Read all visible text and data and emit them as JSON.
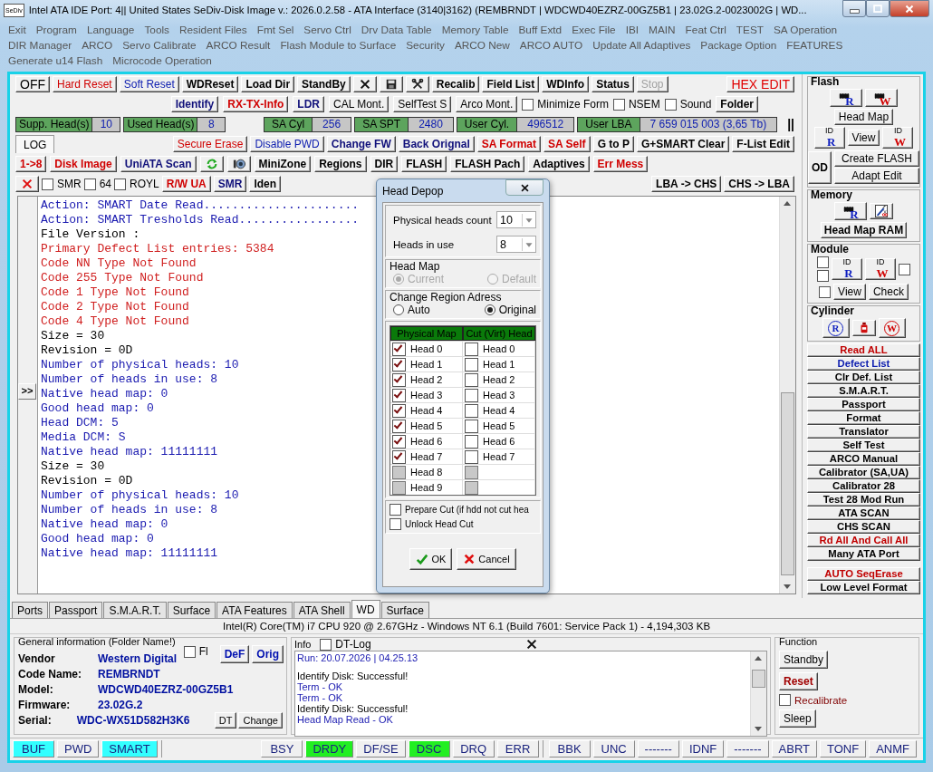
{
  "window": {
    "app_logo": "SeDiv",
    "title": "Intel ATA IDE  Port: 4|| United States  SeDiv-Disk Image v.: 2026.0.2.58 - ATA Interface (3140|3162)  (REMBRNDT | WDCWD40EZRZ-00GZ5B1 | 23.02G.2-0023002G | WD..."
  },
  "menu": [
    "Exit",
    "Program",
    "Language",
    "Tools",
    "Resident Files",
    "Fmt Sel",
    "Servo Ctrl",
    "Drv Data Table",
    "Memory Table",
    "Buff Extd",
    "Exec File",
    "IBI",
    "MAIN",
    "Feat Ctrl",
    "TEST",
    "SA Operation",
    "DIR Manager",
    "ARCO",
    "Servo Calibrate",
    "ARCO Result",
    "Flash Module to Surface",
    "Security",
    "ARCO New",
    "ARCO AUTO",
    "Update All Adaptives",
    "Package Option",
    "FEATURES",
    "Generate u14 Flash",
    "Microcode Operation"
  ],
  "toolbar_rows": [
    {
      "left": [
        {
          "kind": "button",
          "label": "OFF",
          "color": "#000000",
          "bold": false,
          "big": true
        },
        {
          "kind": "button",
          "label": "Hard Reset",
          "color": "#d00000",
          "bold": false
        },
        {
          "kind": "button",
          "label": "Soft Reset",
          "color": "#1020b0",
          "bold": false
        },
        {
          "kind": "button",
          "label": "WDReset",
          "color": "#000000",
          "bold": true
        },
        {
          "kind": "button",
          "label": "Load Dir",
          "color": "#000000",
          "bold": true
        },
        {
          "kind": "button",
          "label": "StandBy",
          "color": "#000000",
          "bold": true
        },
        {
          "kind": "close_button"
        },
        {
          "kind": "save_button"
        },
        {
          "kind": "tools_button"
        },
        {
          "kind": "button",
          "label": "Recalib",
          "color": "#000000",
          "bold": true
        },
        {
          "kind": "button",
          "label": "Field List",
          "color": "#000000",
          "bold": true
        },
        {
          "kind": "button",
          "label": "WDInfo",
          "color": "#000000",
          "bold": true
        },
        {
          "kind": "button",
          "label": "Status",
          "color": "#000000",
          "bold": true
        },
        {
          "kind": "button",
          "label": "Stop",
          "bold": false,
          "disabled": true
        }
      ],
      "right": [
        {
          "kind": "button",
          "label": "HEX EDIT",
          "color": "#e00000",
          "bold": false,
          "big": true
        }
      ]
    },
    {
      "right": [
        {
          "kind": "button",
          "label": "Identify",
          "color": "#10107a",
          "bold": true
        },
        {
          "kind": "button",
          "label": "RX-TX-Info",
          "color": "#d00000",
          "bold": true
        },
        {
          "kind": "button",
          "label": "LDR",
          "color": "#10107a",
          "bold": true
        },
        {
          "kind": "button",
          "label": "CAL Mont.",
          "color": "#000000",
          "bold": false
        },
        {
          "kind": "button",
          "label": "SelfTest S",
          "color": "#000000",
          "bold": false
        },
        {
          "kind": "button",
          "label": "Arco Mont.",
          "color": "#000000",
          "bold": false
        },
        {
          "kind": "checkbox",
          "label": "Minimize Form",
          "checked": false
        },
        {
          "kind": "checkbox",
          "label": "NSEM",
          "checked": false
        },
        {
          "kind": "checkbox",
          "label": "Sound",
          "checked": false
        },
        {
          "kind": "button",
          "label": "Folder",
          "color": "#000000",
          "bold": true
        }
      ]
    },
    {
      "left": [
        {
          "kind": "field",
          "label": "Supp. Head(s)",
          "value": "10"
        },
        {
          "kind": "field",
          "label": "Used Head(s)",
          "value": "8"
        }
      ],
      "right": [
        {
          "kind": "field",
          "label": "SA Cyl",
          "value": "256"
        },
        {
          "kind": "field",
          "label": "SA SPT",
          "value": "2480"
        },
        {
          "kind": "field",
          "label": "User Cyl.",
          "value": "496512"
        },
        {
          "kind": "field",
          "label": "User LBA",
          "value": "7 659 015 003  (3,65 Tb)"
        },
        {
          "kind": "text",
          "label": "||"
        }
      ]
    },
    {
      "left": [
        {
          "kind": "tab",
          "label": "LOG",
          "selected": true
        }
      ],
      "right": [
        {
          "kind": "button",
          "label": "Secure Erase",
          "color": "#d00000",
          "bold": false
        },
        {
          "kind": "button",
          "label": "Disable PWD",
          "color": "#1020b0",
          "bold": false
        },
        {
          "kind": "button",
          "label": "Change FW",
          "color": "#10107a",
          "bold": true
        },
        {
          "kind": "button",
          "label": "Back Orignal",
          "color": "#10107a",
          "bold": true
        },
        {
          "kind": "button",
          "label": "SA Format",
          "color": "#d00000",
          "bold": true
        },
        {
          "kind": "button",
          "label": "SA Self",
          "color": "#d00000",
          "bold": true
        },
        {
          "kind": "button",
          "label": "G to P",
          "color": "#000000",
          "bold": true
        },
        {
          "kind": "button",
          "label": "G+SMART Clear",
          "color": "#000000",
          "bold": true
        },
        {
          "kind": "button",
          "label": "F-List Edit",
          "color": "#000000",
          "bold": true
        }
      ]
    },
    {
      "left": [
        {
          "kind": "button",
          "label": "1->8",
          "color": "#d00000",
          "bold": true
        },
        {
          "kind": "button",
          "label": "Disk Image",
          "color": "#d00000",
          "bold": true
        },
        {
          "kind": "button",
          "label": "UniATA Scan",
          "color": "#10107a",
          "bold": true
        },
        {
          "kind": "refresh_button"
        },
        {
          "kind": "camera_button"
        },
        {
          "kind": "button",
          "label": "MiniZone",
          "color": "#000000",
          "bold": true
        },
        {
          "kind": "button",
          "label": "Regions",
          "color": "#000000",
          "bold": true
        },
        {
          "kind": "button",
          "label": "DIR",
          "color": "#000000",
          "bold": true
        },
        {
          "kind": "button",
          "label": "FLASH",
          "color": "#000000",
          "bold": true
        },
        {
          "kind": "button",
          "label": "FLASH Pach",
          "color": "#000000",
          "bold": true
        },
        {
          "kind": "button",
          "label": "Adaptives",
          "color": "#000000",
          "bold": true
        },
        {
          "kind": "button",
          "label": "Err Mess",
          "color": "#d00000",
          "bold": true
        }
      ]
    },
    {
      "left": [
        {
          "kind": "delete_button"
        },
        {
          "kind": "checkbox",
          "label": "SMR",
          "checked": false
        },
        {
          "kind": "checkbox",
          "label": "64",
          "checked": false
        },
        {
          "kind": "checkbox",
          "label": "ROYL",
          "checked": false
        },
        {
          "kind": "button",
          "label": "R/W UA",
          "color": "#d00000",
          "bold": true
        },
        {
          "kind": "button",
          "label": "SMR",
          "color": "#10107a",
          "bold": true
        },
        {
          "kind": "button",
          "label": "Iden",
          "color": "#000000",
          "bold": true
        }
      ],
      "right": [
        {
          "kind": "button",
          "label": "LBA -> CHS",
          "color": "#000000",
          "bold": true
        },
        {
          "kind": "button",
          "label": "CHS -> LBA",
          "color": "#000000",
          "bold": true
        }
      ]
    }
  ],
  "log": {
    "expand_button": ">>",
    "lines": [
      {
        "text": "Action: SMART Date Read......................",
        "color": "#1a1ab0"
      },
      {
        "text": "Action: SMART Tresholds Read.................",
        "color": "#1a1ab0"
      },
      {
        "text": "File Version :",
        "color": "#000000"
      },
      {
        "text": "Primary Defect List entries: 5384",
        "color": "#d02020"
      },
      {
        "text": "Code NN Type Not Found",
        "color": "#d02020"
      },
      {
        "text": "Code 255 Type Not Found",
        "color": "#d02020"
      },
      {
        "text": "Code 1 Type Not Found",
        "color": "#d02020"
      },
      {
        "text": "Code 2 Type Not Found",
        "color": "#d02020"
      },
      {
        "text": "Code 4 Type Not Found",
        "color": "#d02020"
      },
      {
        "text": "Size = 30",
        "color": "#000000"
      },
      {
        "text": "Revision = 0D",
        "color": "#000000"
      },
      {
        "text": "Number of physical heads: 10",
        "color": "#1a1ab0"
      },
      {
        "text": "Number of heads in use: 8",
        "color": "#1a1ab0"
      },
      {
        "text": "Native head map: 0",
        "color": "#1a1ab0"
      },
      {
        "text": "Good head map: 0",
        "color": "#1a1ab0"
      },
      {
        "text": "Head DCM: 5",
        "color": "#1a1ab0"
      },
      {
        "text": "Media DCM: S",
        "color": "#1a1ab0"
      },
      {
        "text": "Native head map: 11111111",
        "color": "#1a1ab0"
      },
      {
        "text": "Size = 30",
        "color": "#000000"
      },
      {
        "text": "Revision = 0D",
        "color": "#000000"
      },
      {
        "text": "Number of physical heads: 10",
        "color": "#1a1ab0"
      },
      {
        "text": "Number of heads in use: 8",
        "color": "#1a1ab0"
      },
      {
        "text": "Native head map: 0",
        "color": "#1a1ab0"
      },
      {
        "text": "Good head map: 0",
        "color": "#1a1ab0"
      },
      {
        "text": "Native head map: 11111111",
        "color": "#1a1ab0"
      }
    ]
  },
  "dialog": {
    "title": "Head Depop",
    "combos": [
      {
        "label": "Physical heads count",
        "value": "10"
      },
      {
        "label": "Heads in use",
        "value": "8"
      }
    ],
    "radio_groups": [
      {
        "title": "Head Map",
        "options": [
          {
            "label": "Current",
            "selected": true,
            "disabled": true
          },
          {
            "label": "Default",
            "selected": false,
            "disabled": true
          }
        ]
      },
      {
        "title": "Change Region Adress",
        "options": [
          {
            "label": "Auto",
            "selected": false,
            "disabled": false
          },
          {
            "label": "Original",
            "selected": true,
            "disabled": false
          }
        ]
      }
    ],
    "columns": [
      "Physical Map",
      "Cut (Virt) Head"
    ],
    "heads": [
      {
        "physical": {
          "label": "Head 0",
          "checked": true,
          "disabled": false
        },
        "cut": {
          "label": "Head 0",
          "checked": false,
          "disabled": false
        }
      },
      {
        "physical": {
          "label": "Head 1",
          "checked": true,
          "disabled": false
        },
        "cut": {
          "label": "Head 1",
          "checked": false,
          "disabled": false
        }
      },
      {
        "physical": {
          "label": "Head 2",
          "checked": true,
          "disabled": false
        },
        "cut": {
          "label": "Head 2",
          "checked": false,
          "disabled": false
        }
      },
      {
        "physical": {
          "label": "Head 3",
          "checked": true,
          "disabled": false
        },
        "cut": {
          "label": "Head 3",
          "checked": false,
          "disabled": false
        }
      },
      {
        "physical": {
          "label": "Head 4",
          "checked": true,
          "disabled": false
        },
        "cut": {
          "label": "Head 4",
          "checked": false,
          "disabled": false
        }
      },
      {
        "physical": {
          "label": "Head 5",
          "checked": true,
          "disabled": false
        },
        "cut": {
          "label": "Head 5",
          "checked": false,
          "disabled": false
        }
      },
      {
        "physical": {
          "label": "Head 6",
          "checked": true,
          "disabled": false
        },
        "cut": {
          "label": "Head 6",
          "checked": false,
          "disabled": false
        }
      },
      {
        "physical": {
          "label": "Head 7",
          "checked": true,
          "disabled": false
        },
        "cut": {
          "label": "Head 7",
          "checked": false,
          "disabled": false
        }
      },
      {
        "physical": {
          "label": "Head 8",
          "checked": false,
          "disabled": true
        },
        "cut": {
          "checked": false,
          "disabled": true
        }
      },
      {
        "physical": {
          "label": "Head 9",
          "checked": false,
          "disabled": true
        },
        "cut": {
          "checked": false,
          "disabled": true
        }
      }
    ],
    "options": [
      {
        "label": "Prepare Cut (if hdd not cut hea",
        "checked": false
      },
      {
        "label": "Unlock Head Cut",
        "checked": false
      }
    ],
    "buttons": [
      {
        "label": "OK"
      },
      {
        "label": "Cancel"
      }
    ]
  },
  "side_panel": {
    "groups": [
      {
        "title": "Flash",
        "rows": [
          [
            {
              "kind": "chip_button",
              "letter": "R",
              "color": "#1020c0"
            },
            {
              "kind": "chip_button",
              "letter": "W",
              "color": "#d00000"
            }
          ],
          [
            {
              "kind": "button",
              "label": "Head Map",
              "color": "#000000",
              "bold": false
            }
          ],
          [
            {
              "kind": "id_button",
              "label": "ID",
              "letter": "R",
              "color": "#1020c0"
            },
            {
              "kind": "button",
              "label": "View",
              "color": "#000000",
              "bold": false
            },
            {
              "kind": "id_button",
              "label": "ID",
              "letter": "W",
              "color": "#d00000"
            }
          ],
          [
            {
              "kind": "button",
              "label": "OD",
              "color": "#000000",
              "bold": true,
              "big": true
            },
            {
              "kind": "button_stack",
              "buttons": [
                {
                  "label": "Create FLASH"
                },
                {
                  "label": "Adapt Edit"
                }
              ]
            }
          ]
        ]
      },
      {
        "title": "Memory",
        "rows": [
          [
            {
              "kind": "chip_button",
              "letter": "R",
              "color": "#1020c0"
            },
            {
              "kind": "tools_art_button"
            }
          ],
          [
            {
              "kind": "button",
              "label": "Head Map RAM",
              "color": "#000000",
              "bold": true
            }
          ]
        ]
      },
      {
        "title": "Module",
        "rows": [
          [
            {
              "kind": "checkbox_stack",
              "boxes": [
                {
                  "checked": false
                },
                {
                  "checked": false
                }
              ]
            },
            {
              "kind": "id_button",
              "label": "ID",
              "letter": "R",
              "color": "#1020c0"
            },
            {
              "kind": "id_button",
              "label": "ID",
              "letter": "W",
              "color": "#d00000"
            },
            {
              "kind": "checkbox",
              "checked": false
            }
          ],
          [
            {
              "kind": "checkbox",
              "checked": false
            },
            {
              "kind": "button",
              "label": "View",
              "color": "#000000",
              "bold": false
            },
            {
              "kind": "button",
              "label": "Check",
              "color": "#000000",
              "bold": false
            }
          ]
        ]
      },
      {
        "title": "Cylinder",
        "rows": [
          [
            {
              "kind": "circle_button",
              "letter": "R",
              "color": "#1020c0"
            },
            {
              "kind": "bottle_button"
            },
            {
              "kind": "circle_button",
              "letter": "W",
              "color": "#d00000"
            }
          ]
        ]
      }
    ],
    "actions": [
      {
        "label": "Read ALL",
        "color": "#c00000"
      },
      {
        "label": "Defect List",
        "color": "#1020b0"
      },
      {
        "label": "Clr Def. List",
        "color": "#000000"
      },
      {
        "label": "S.M.A.R.T.",
        "color": "#000000"
      },
      {
        "label": "Passport",
        "color": "#000000"
      },
      {
        "label": "Format",
        "color": "#000000"
      },
      {
        "label": "Translator",
        "color": "#000000"
      },
      {
        "label": "Self Test",
        "color": "#000000"
      },
      {
        "label": "ARCO Manual",
        "color": "#000000"
      },
      {
        "label": "Calibrator (SA,UA)",
        "color": "#000000"
      },
      {
        "label": "Calibrator 28",
        "color": "#000000"
      },
      {
        "label": "Test 28 Mod Run",
        "color": "#000000"
      },
      {
        "label": "ATA SCAN",
        "color": "#000000"
      },
      {
        "label": "CHS SCAN",
        "color": "#000000"
      },
      {
        "label": "Rd All And Call All",
        "color": "#c00000"
      },
      {
        "label": "Many ATA Port",
        "color": "#000000"
      }
    ],
    "actions_bottom": [
      {
        "label": "AUTO SeqErase",
        "color": "#c00000"
      },
      {
        "label": "Low Level Format",
        "color": "#000000"
      }
    ]
  },
  "bottom_tabs": [
    {
      "label": "Ports",
      "selected": false
    },
    {
      "label": "Passport",
      "selected": false
    },
    {
      "label": "S.M.A.R.T.",
      "selected": false
    },
    {
      "label": "Surface",
      "selected": false
    },
    {
      "label": "ATA Features",
      "selected": false
    },
    {
      "label": "ATA Shell",
      "selected": false
    },
    {
      "label": "WD",
      "selected": true
    },
    {
      "label": "Surface",
      "selected": false
    }
  ],
  "system_info": "Intel(R) Core(TM) i7 CPU 920  @ 2.67GHz - Windows NT 6.1 (Build 7601: Service Pack 1) -  4,194,303 KB",
  "general_info": {
    "title": "General information (Folder Name!)",
    "fl": {
      "label": "Fl",
      "checked": false
    },
    "buttons": [
      "DeF",
      "Orig"
    ],
    "fields": [
      {
        "label": "Vendor",
        "value": "Western Digital"
      },
      {
        "label": "Code Name:",
        "value": "REMBRNDT"
      },
      {
        "label": "Model:",
        "value": "WDCWD40EZRZ-00GZ5B1"
      },
      {
        "label": "Firmware:",
        "value": "23.02G.2"
      },
      {
        "label": "Serial:",
        "value": "WDC-WX51D582H3K6"
      }
    ],
    "serial_buttons": [
      "DT",
      "Change"
    ]
  },
  "info": {
    "title": "Info",
    "dt_log": {
      "label": "DT-Log",
      "checked": false
    },
    "lines": [
      {
        "text": "Run: 20.07.2026 | 04.25.13",
        "color": "#1a1ab0"
      },
      {
        "text": "Identify Disk: Successful!",
        "color": "#000000"
      },
      {
        "text": "Term - OK",
        "color": "#1a1ab0"
      },
      {
        "text": "Term - OK",
        "color": "#1a1ab0"
      },
      {
        "text": "Identify Disk: Successful!",
        "color": "#000000"
      },
      {
        "text": "Head Map Read - OK",
        "color": "#1a1ab0"
      }
    ]
  },
  "function": {
    "title": "Function",
    "items": [
      {
        "kind": "button",
        "label": "Standby",
        "color": "#000000",
        "bold": false
      },
      {
        "kind": "button",
        "label": "Reset",
        "color": "#a00000",
        "bold": true
      },
      {
        "kind": "checkbox",
        "label": "Recalibrate",
        "checked": false,
        "color": "#800000"
      },
      {
        "kind": "button",
        "label": "Sleep",
        "color": "#000000",
        "bold": false
      }
    ]
  },
  "status_bar": [
    [
      {
        "label": "BUF",
        "color": "#33ffff"
      },
      {
        "label": "PWD",
        "color": "#f0f0f0"
      },
      {
        "label": "SMART",
        "color": "#33ffff"
      }
    ],
    [
      {
        "label": "BSY",
        "color": "#f0f0f0"
      },
      {
        "label": "DRDY",
        "color": "#22ee22"
      },
      {
        "label": "DF/SE",
        "color": "#f0f0f0"
      },
      {
        "label": "DSC",
        "color": "#22ee22"
      },
      {
        "label": "DRQ",
        "color": "#f0f0f0"
      },
      {
        "label": "ERR",
        "color": "#f0f0f0"
      }
    ],
    [
      {
        "label": "BBK",
        "color": "#f0f0f0"
      },
      {
        "label": "UNC",
        "color": "#f0f0f0"
      },
      {
        "label": "-------",
        "color": "#f0f0f0"
      },
      {
        "label": "IDNF",
        "color": "#f0f0f0"
      },
      {
        "label": "-------",
        "color": "#f0f0f0"
      },
      {
        "label": "ABRT",
        "color": "#f0f0f0"
      },
      {
        "label": "TONF",
        "color": "#f0f0f0"
      },
      {
        "label": "ANMF",
        "color": "#f0f0f0"
      }
    ]
  ]
}
